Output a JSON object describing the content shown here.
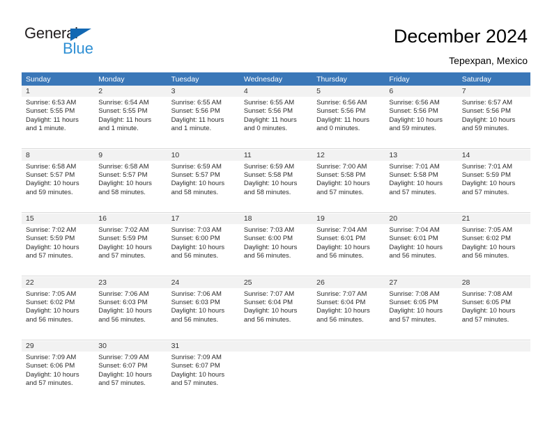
{
  "brand": {
    "name_part1": "General",
    "name_part2": "Blue",
    "triangle_color": "#1268b3",
    "blue_color": "#2e8fd4"
  },
  "header": {
    "title": "December 2024",
    "location": "Tepexpan, Mexico",
    "accent_color": "#3a77b8",
    "daynum_bg": "#f2f2f2"
  },
  "weekdays": [
    "Sunday",
    "Monday",
    "Tuesday",
    "Wednesday",
    "Thursday",
    "Friday",
    "Saturday"
  ],
  "labels": {
    "sunrise": "Sunrise:",
    "sunset": "Sunset:",
    "daylight": "Daylight:"
  },
  "weeks": [
    [
      {
        "day": "1",
        "sunrise": "Sunrise: 6:53 AM",
        "sunset": "Sunset: 5:55 PM",
        "daylight_line1": "Daylight: 11 hours",
        "daylight_line2": "and 1 minute."
      },
      {
        "day": "2",
        "sunrise": "Sunrise: 6:54 AM",
        "sunset": "Sunset: 5:55 PM",
        "daylight_line1": "Daylight: 11 hours",
        "daylight_line2": "and 1 minute."
      },
      {
        "day": "3",
        "sunrise": "Sunrise: 6:55 AM",
        "sunset": "Sunset: 5:56 PM",
        "daylight_line1": "Daylight: 11 hours",
        "daylight_line2": "and 1 minute."
      },
      {
        "day": "4",
        "sunrise": "Sunrise: 6:55 AM",
        "sunset": "Sunset: 5:56 PM",
        "daylight_line1": "Daylight: 11 hours",
        "daylight_line2": "and 0 minutes."
      },
      {
        "day": "5",
        "sunrise": "Sunrise: 6:56 AM",
        "sunset": "Sunset: 5:56 PM",
        "daylight_line1": "Daylight: 11 hours",
        "daylight_line2": "and 0 minutes."
      },
      {
        "day": "6",
        "sunrise": "Sunrise: 6:56 AM",
        "sunset": "Sunset: 5:56 PM",
        "daylight_line1": "Daylight: 10 hours",
        "daylight_line2": "and 59 minutes."
      },
      {
        "day": "7",
        "sunrise": "Sunrise: 6:57 AM",
        "sunset": "Sunset: 5:56 PM",
        "daylight_line1": "Daylight: 10 hours",
        "daylight_line2": "and 59 minutes."
      }
    ],
    [
      {
        "day": "8",
        "sunrise": "Sunrise: 6:58 AM",
        "sunset": "Sunset: 5:57 PM",
        "daylight_line1": "Daylight: 10 hours",
        "daylight_line2": "and 59 minutes."
      },
      {
        "day": "9",
        "sunrise": "Sunrise: 6:58 AM",
        "sunset": "Sunset: 5:57 PM",
        "daylight_line1": "Daylight: 10 hours",
        "daylight_line2": "and 58 minutes."
      },
      {
        "day": "10",
        "sunrise": "Sunrise: 6:59 AM",
        "sunset": "Sunset: 5:57 PM",
        "daylight_line1": "Daylight: 10 hours",
        "daylight_line2": "and 58 minutes."
      },
      {
        "day": "11",
        "sunrise": "Sunrise: 6:59 AM",
        "sunset": "Sunset: 5:58 PM",
        "daylight_line1": "Daylight: 10 hours",
        "daylight_line2": "and 58 minutes."
      },
      {
        "day": "12",
        "sunrise": "Sunrise: 7:00 AM",
        "sunset": "Sunset: 5:58 PM",
        "daylight_line1": "Daylight: 10 hours",
        "daylight_line2": "and 57 minutes."
      },
      {
        "day": "13",
        "sunrise": "Sunrise: 7:01 AM",
        "sunset": "Sunset: 5:58 PM",
        "daylight_line1": "Daylight: 10 hours",
        "daylight_line2": "and 57 minutes."
      },
      {
        "day": "14",
        "sunrise": "Sunrise: 7:01 AM",
        "sunset": "Sunset: 5:59 PM",
        "daylight_line1": "Daylight: 10 hours",
        "daylight_line2": "and 57 minutes."
      }
    ],
    [
      {
        "day": "15",
        "sunrise": "Sunrise: 7:02 AM",
        "sunset": "Sunset: 5:59 PM",
        "daylight_line1": "Daylight: 10 hours",
        "daylight_line2": "and 57 minutes."
      },
      {
        "day": "16",
        "sunrise": "Sunrise: 7:02 AM",
        "sunset": "Sunset: 5:59 PM",
        "daylight_line1": "Daylight: 10 hours",
        "daylight_line2": "and 57 minutes."
      },
      {
        "day": "17",
        "sunrise": "Sunrise: 7:03 AM",
        "sunset": "Sunset: 6:00 PM",
        "daylight_line1": "Daylight: 10 hours",
        "daylight_line2": "and 56 minutes."
      },
      {
        "day": "18",
        "sunrise": "Sunrise: 7:03 AM",
        "sunset": "Sunset: 6:00 PM",
        "daylight_line1": "Daylight: 10 hours",
        "daylight_line2": "and 56 minutes."
      },
      {
        "day": "19",
        "sunrise": "Sunrise: 7:04 AM",
        "sunset": "Sunset: 6:01 PM",
        "daylight_line1": "Daylight: 10 hours",
        "daylight_line2": "and 56 minutes."
      },
      {
        "day": "20",
        "sunrise": "Sunrise: 7:04 AM",
        "sunset": "Sunset: 6:01 PM",
        "daylight_line1": "Daylight: 10 hours",
        "daylight_line2": "and 56 minutes."
      },
      {
        "day": "21",
        "sunrise": "Sunrise: 7:05 AM",
        "sunset": "Sunset: 6:02 PM",
        "daylight_line1": "Daylight: 10 hours",
        "daylight_line2": "and 56 minutes."
      }
    ],
    [
      {
        "day": "22",
        "sunrise": "Sunrise: 7:05 AM",
        "sunset": "Sunset: 6:02 PM",
        "daylight_line1": "Daylight: 10 hours",
        "daylight_line2": "and 56 minutes."
      },
      {
        "day": "23",
        "sunrise": "Sunrise: 7:06 AM",
        "sunset": "Sunset: 6:03 PM",
        "daylight_line1": "Daylight: 10 hours",
        "daylight_line2": "and 56 minutes."
      },
      {
        "day": "24",
        "sunrise": "Sunrise: 7:06 AM",
        "sunset": "Sunset: 6:03 PM",
        "daylight_line1": "Daylight: 10 hours",
        "daylight_line2": "and 56 minutes."
      },
      {
        "day": "25",
        "sunrise": "Sunrise: 7:07 AM",
        "sunset": "Sunset: 6:04 PM",
        "daylight_line1": "Daylight: 10 hours",
        "daylight_line2": "and 56 minutes."
      },
      {
        "day": "26",
        "sunrise": "Sunrise: 7:07 AM",
        "sunset": "Sunset: 6:04 PM",
        "daylight_line1": "Daylight: 10 hours",
        "daylight_line2": "and 56 minutes."
      },
      {
        "day": "27",
        "sunrise": "Sunrise: 7:08 AM",
        "sunset": "Sunset: 6:05 PM",
        "daylight_line1": "Daylight: 10 hours",
        "daylight_line2": "and 57 minutes."
      },
      {
        "day": "28",
        "sunrise": "Sunrise: 7:08 AM",
        "sunset": "Sunset: 6:05 PM",
        "daylight_line1": "Daylight: 10 hours",
        "daylight_line2": "and 57 minutes."
      }
    ],
    [
      {
        "day": "29",
        "sunrise": "Sunrise: 7:09 AM",
        "sunset": "Sunset: 6:06 PM",
        "daylight_line1": "Daylight: 10 hours",
        "daylight_line2": "and 57 minutes."
      },
      {
        "day": "30",
        "sunrise": "Sunrise: 7:09 AM",
        "sunset": "Sunset: 6:07 PM",
        "daylight_line1": "Daylight: 10 hours",
        "daylight_line2": "and 57 minutes."
      },
      {
        "day": "31",
        "sunrise": "Sunrise: 7:09 AM",
        "sunset": "Sunset: 6:07 PM",
        "daylight_line1": "Daylight: 10 hours",
        "daylight_line2": "and 57 minutes."
      },
      null,
      null,
      null,
      null
    ]
  ]
}
